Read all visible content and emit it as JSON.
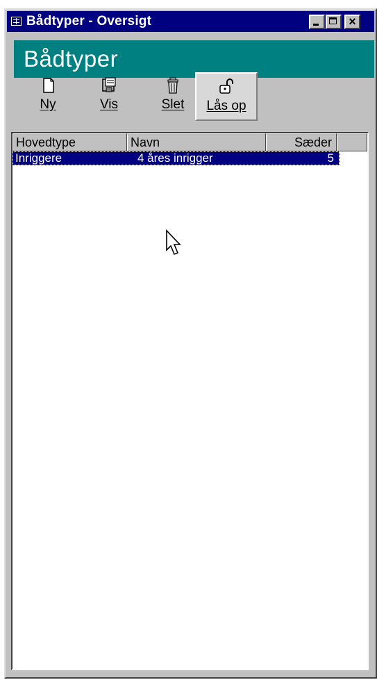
{
  "window": {
    "title": "Bådtyper - Oversigt",
    "header": "Bådtyper",
    "titlebar_color": "#000080",
    "header_color": "#008080"
  },
  "toolbar": {
    "buttons": [
      {
        "label": "Ny",
        "icon": "new-document-icon"
      },
      {
        "label": "Vis",
        "icon": "view-icon"
      },
      {
        "label": "Slet",
        "icon": "trash-can-icon"
      },
      {
        "label": "Lås op",
        "icon": "unlock-padlock-icon",
        "pressed": true
      }
    ]
  },
  "list": {
    "columns": [
      "Hovedtype",
      "Navn",
      "Sæder"
    ],
    "rows": [
      {
        "hovedtype": "Inriggere",
        "navn": "4 åres inrigger",
        "saeder": "5",
        "selected": true
      }
    ],
    "selection_color": "#000080"
  }
}
